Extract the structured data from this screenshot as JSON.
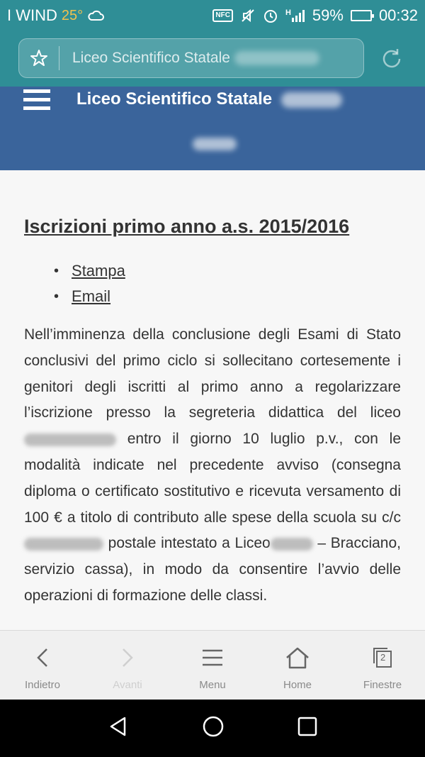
{
  "status_bar": {
    "carrier": "I WIND",
    "temperature": "25°",
    "nfc_label": "NFC",
    "network_type": "H",
    "battery_percent": "59%",
    "battery_level": 0.59,
    "time": "00:32"
  },
  "address_bar": {
    "url_text": "Liceo Scientifico Statale"
  },
  "site_header": {
    "title": "Liceo Scientifico Statale"
  },
  "article": {
    "title": "Iscrizioni primo anno a.s. 2015/2016",
    "links": [
      {
        "label": " Stampa "
      },
      {
        "label": " Email"
      }
    ],
    "body": {
      "part1": "Nell’imminenza della conclusione degli Esami di Stato conclusivi del primo ciclo si sollecitano cortesemente i genitori degli iscritti al primo anno a regolarizzare l’iscrizione presso la segreteria didattica del liceo ",
      "part2": " entro il giorno 10 luglio p.v., con le modalità indicate nel precedente avviso (consegna diploma o certificato sostitutivo e ricevuta versamento di 100 € a titolo di contributo alle spese della scuola su c/c ",
      "part3": " postale intestato a Liceo",
      "part4": " – Bracciano, servizio cassa), in modo da consentire l’avvio delle operazioni di formazione delle classi."
    }
  },
  "toolbar": {
    "back": "Indietro",
    "forward": "Avanti",
    "menu": "Menu",
    "home": "Home",
    "windows": "Finestre",
    "windows_count": "2"
  },
  "colors": {
    "status_bg": "#2f8e96",
    "header_bg": "#3a649b"
  }
}
